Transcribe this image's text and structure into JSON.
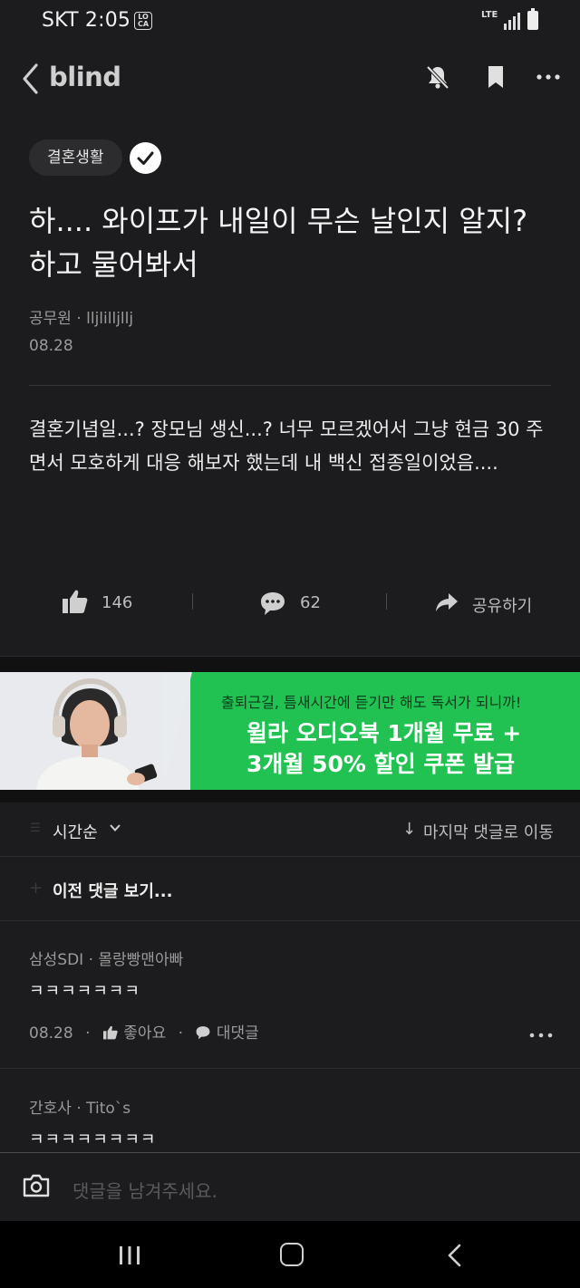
{
  "status_bar": {
    "time": "SKT 2:05",
    "loca_badge": "LO CA",
    "network": "LTE"
  },
  "header": {
    "logo": "blind",
    "icons": [
      "back-icon",
      "bell-off-icon",
      "bookmark-icon",
      "more-icon"
    ]
  },
  "post": {
    "category": "결혼생활",
    "title": "하.... 와이프가 내일이 무슨 날인지 알지? 하고 물어봐서",
    "author": "공무원 · lljlilljllj",
    "date": "08.28",
    "body": "결혼기념일...? 장모님 생신...? 너무 모르겠어서 그냥 현금 30 주면서 모호하게 대응 해보자 했는데 내 백신 접종일이었음...."
  },
  "actions": {
    "likes": "146",
    "comments": "62",
    "share_label": "공유하기"
  },
  "ad": {
    "line1": "출퇴근길, 틈새시간에 듣기만 해도 독서가 되니까!",
    "line2": "윌라 오디오북 1개월 무료 +",
    "line3": "3개월 50% 할인 쿠폰 발급",
    "accent": "#21c252"
  },
  "comments_section": {
    "sort_label": "시간순",
    "jump_label": "마지막 댓글로 이동",
    "prev_label": "이전 댓글 보기...",
    "comments": [
      {
        "author": "삼성SDI · 몰랑빵맨아빠",
        "text": "ㅋㅋㅋㅋㅋㅋㅋ",
        "date": "08.28",
        "like_label": "좋아요",
        "reply_label": "대댓글"
      },
      {
        "author": "간호사 · Tito`s",
        "text": "ㅋㅋㅋㅋㅋㅋㅋㅋ"
      }
    ]
  },
  "input": {
    "placeholder": "댓글을 남겨주세요."
  }
}
